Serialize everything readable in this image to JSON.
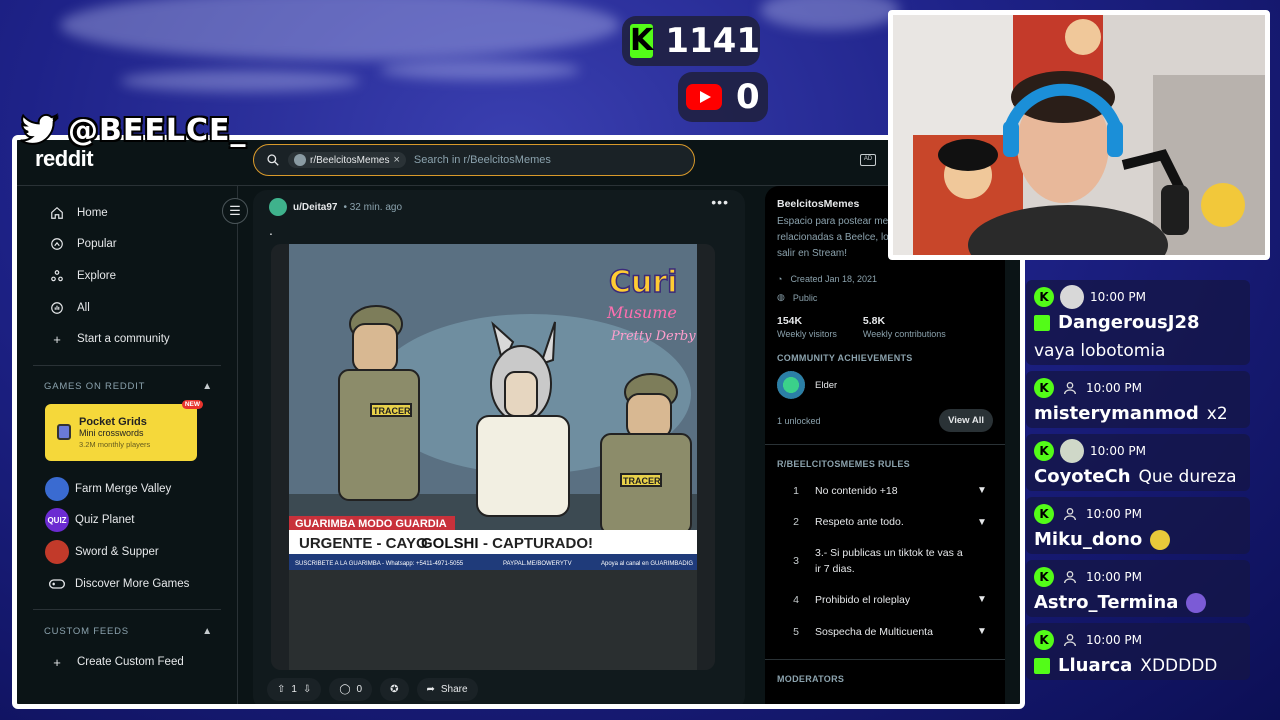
{
  "overlay": {
    "kick_count": "1141",
    "youtube_count": "0",
    "twitter_handle": "@BEELCE_"
  },
  "reddit": {
    "logo_text": "reddit",
    "search": {
      "chip_label": "r/BeelcitosMemes",
      "chip_close": "×",
      "placeholder": "Search in r/BeelcitosMemes"
    },
    "nav": [
      {
        "label": "Home",
        "icon": "home-icon"
      },
      {
        "label": "Popular",
        "icon": "popular-icon"
      },
      {
        "label": "Explore",
        "icon": "explore-icon"
      },
      {
        "label": "All",
        "icon": "all-icon"
      },
      {
        "label": "Start a community",
        "icon": "plus-icon"
      }
    ],
    "games_section": {
      "heading": "GAMES ON REDDIT",
      "featured": {
        "title": "Pocket Grids",
        "subtitle": "Mini crosswords",
        "meta": "3.2M monthly players",
        "badge": "NEW"
      },
      "games": [
        {
          "label": "Farm Merge Valley",
          "color": "#3a6bd1"
        },
        {
          "label": "Quiz Planet",
          "color": "#6b2bd1",
          "thumb_text": "QUIZ"
        },
        {
          "label": "Sword & Supper",
          "color": "#c23a2a"
        },
        {
          "label": "Discover More Games",
          "icon": "gamepad-icon"
        }
      ]
    },
    "custom_feeds": {
      "heading": "CUSTOM FEEDS",
      "create_label": "Create Custom Feed"
    },
    "post": {
      "author": "u/Deita97",
      "time": "• 32 min. ago",
      "more": "•••",
      "title": ".",
      "image": {
        "logo_line1": "Curi",
        "logo_line2": "Musume",
        "logo_line3": "Pretty Derby",
        "banner_top": "GUARIMBA MODO GUARDIA",
        "banner_main_left": "URGENTE - CAYO",
        "banner_main_name": "GOLSHI",
        "banner_main_right": "- CAPTURADO!",
        "ticker_1": "SUSCRIBETE A LA GUARIMBA - Whatsapp: +5411-4971-5055",
        "ticker_2": "PAYPAL.ME/BOWERYTV",
        "ticker_3": "Apoya al canal en GUARIMBADIG",
        "vest_label": "TRACER"
      },
      "votes": "1",
      "comments": "0",
      "share_label": "Share"
    },
    "sidebar": {
      "name": "BeelcitosMemes",
      "description": "Espacio para postear me relacionadas a Beelce, lo salir en Stream!",
      "created": "Created Jan 18, 2021",
      "visibility": "Public",
      "stats": [
        {
          "value": "154K",
          "label": "Weekly visitors"
        },
        {
          "value": "5.8K",
          "label": "Weekly contributions"
        }
      ],
      "achievements_heading": "COMMUNITY ACHIEVEMENTS",
      "achievement_name": "Elder",
      "unlocked": "1 unlocked",
      "view_all": "View All",
      "rules_heading": "R/BEELCITOSMEMES RULES",
      "rules": [
        {
          "num": "1",
          "text": "No contenido +18",
          "expandable": true
        },
        {
          "num": "2",
          "text": "Respeto ante todo.",
          "expandable": true
        },
        {
          "num": "3",
          "text": "3.- Si publicas un tiktok te vas a ir 7 dias.",
          "expandable": false
        },
        {
          "num": "4",
          "text": "Prohibido el roleplay",
          "expandable": true
        },
        {
          "num": "5",
          "text": "Sospecha de Multicuenta",
          "expandable": true
        }
      ],
      "moderators_heading": "MODERATORS"
    }
  },
  "chat": [
    {
      "time": "10:00 PM",
      "user": "DangerousJ28",
      "text": "vaya lobotomia",
      "avatar": true,
      "sub": true,
      "user_color": "#ffffff"
    },
    {
      "time": "10:00 PM",
      "user": "misterymanmod",
      "text": "x2",
      "avatar": false,
      "sub": false,
      "user_color": "#ffffff"
    },
    {
      "time": "10:00 PM",
      "user": "CoyoteCh",
      "text": "Que dureza",
      "avatar": true,
      "sub": false,
      "user_color": "#ffffff"
    },
    {
      "time": "10:00 PM",
      "user": "Miku_dono",
      "text": "",
      "avatar": false,
      "sub": false,
      "emote": "#e8c93a",
      "user_color": "#ffffff"
    },
    {
      "time": "10:00 PM",
      "user": "Astro_Termina",
      "text": "",
      "avatar": false,
      "sub": false,
      "emote": "#7b5bd6",
      "user_color": "#ffffff"
    },
    {
      "time": "10:00 PM",
      "user": "Lluarca",
      "text": "XDDDDD",
      "avatar": false,
      "sub": true,
      "user_color": "#ffffff"
    }
  ]
}
